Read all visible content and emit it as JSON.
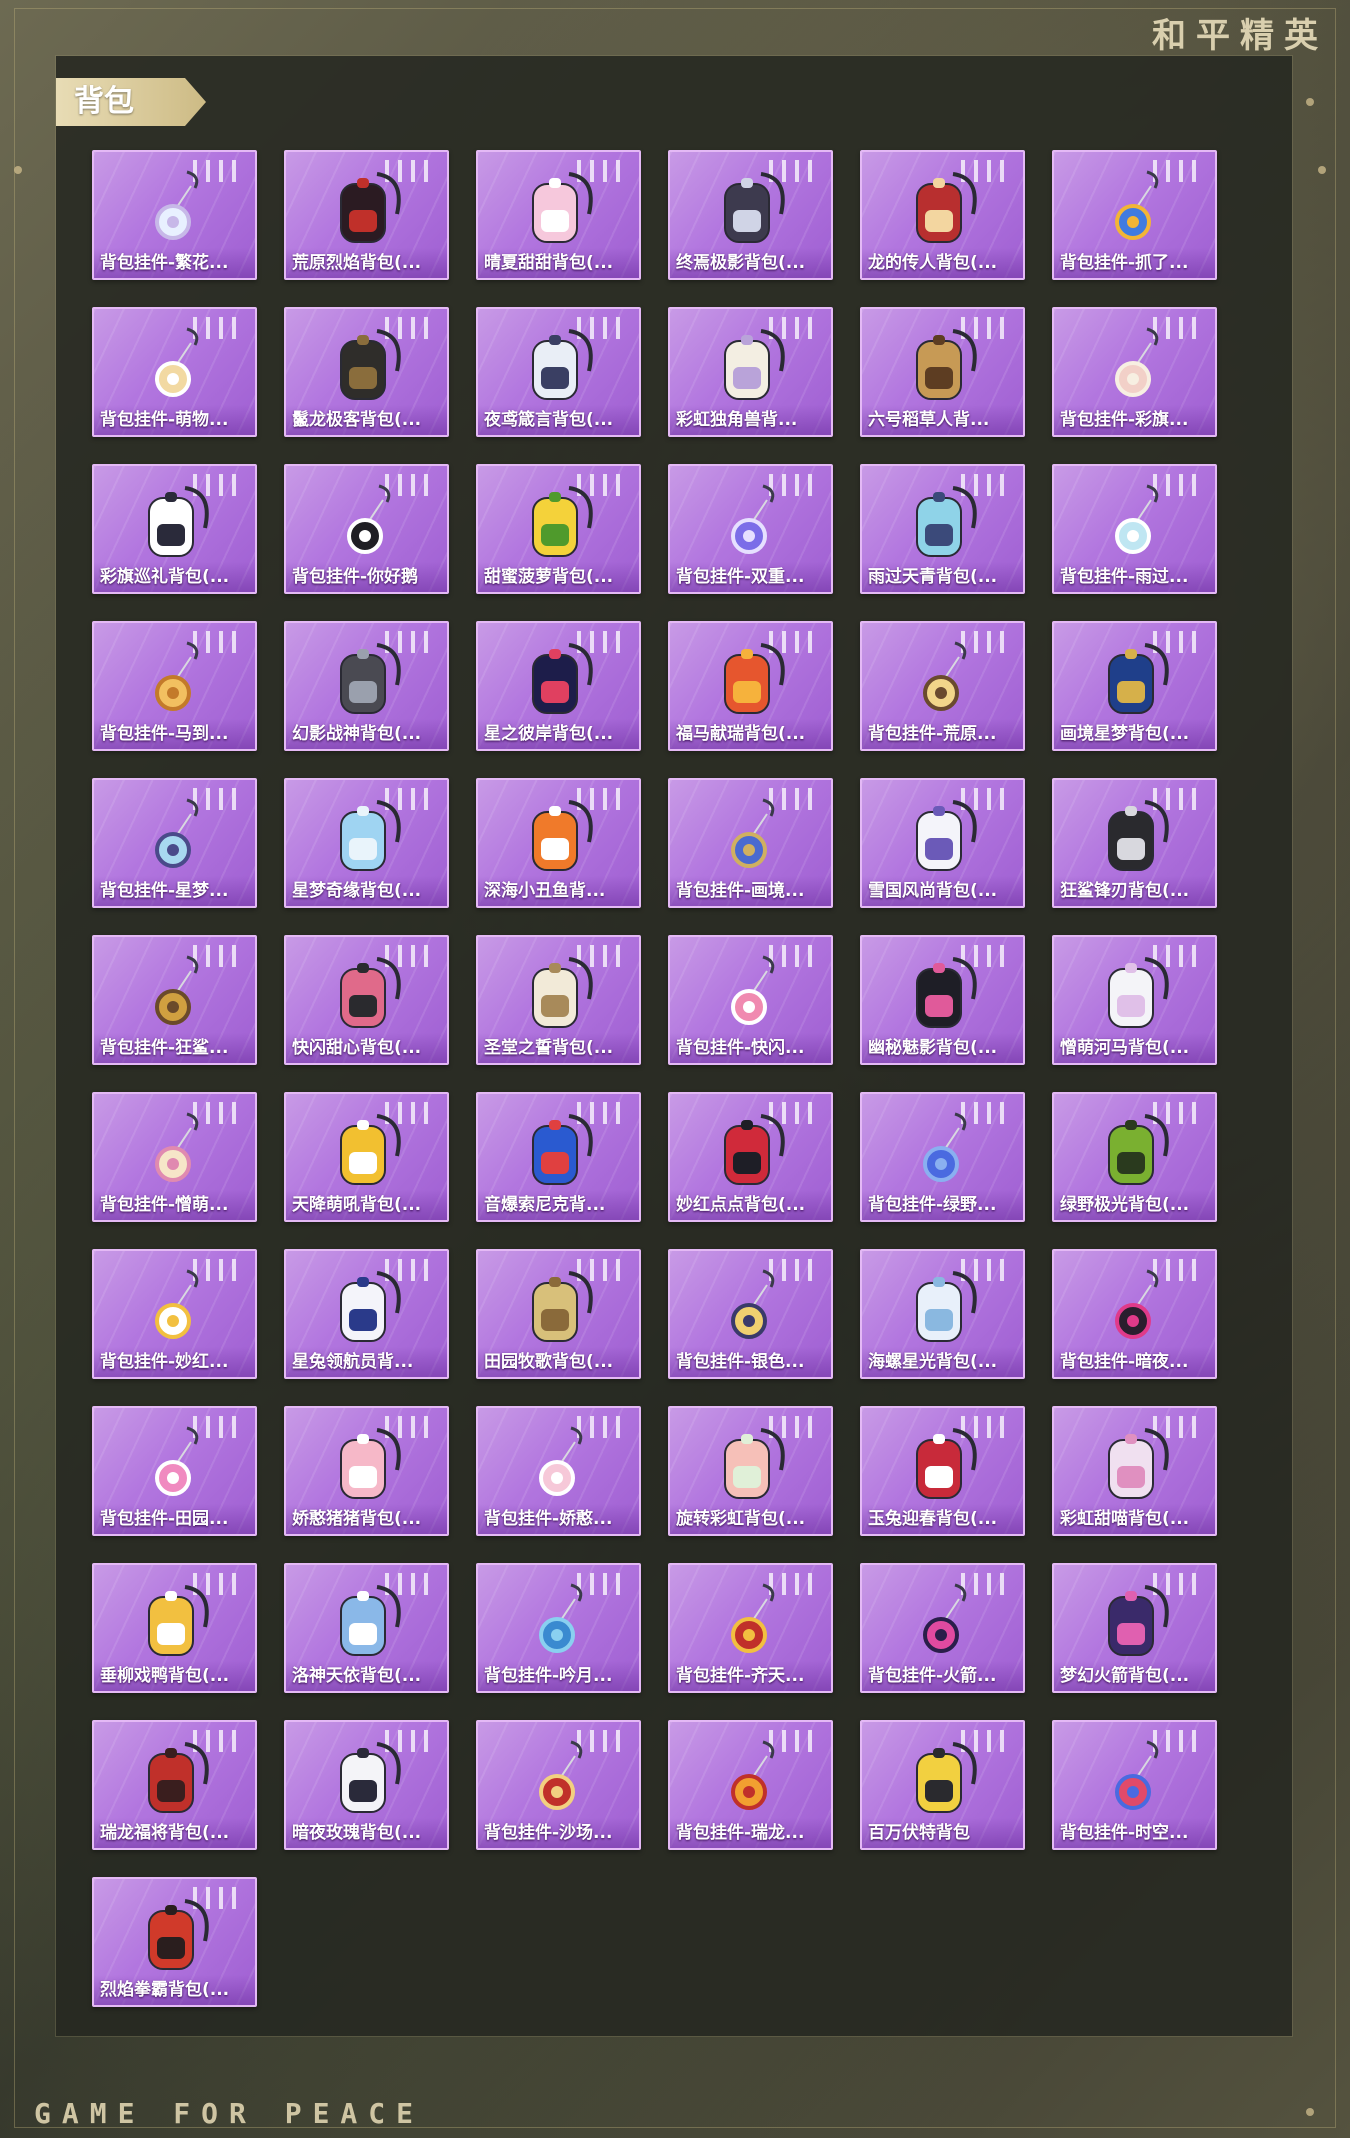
{
  "header": {
    "brand_title": "和平精英"
  },
  "footer": {
    "brand_en": "GAME FOR PEACE"
  },
  "section": {
    "title": "背包"
  },
  "items": [
    {
      "name": "背包挂件-繁花...",
      "type": "charm",
      "colors": [
        "#e8f0ff",
        "#c7b8e8"
      ]
    },
    {
      "name": "荒原烈焰背包(...",
      "type": "backpack",
      "colors": [
        "#2b1b22",
        "#c0302a"
      ]
    },
    {
      "name": "晴夏甜甜背包(...",
      "type": "backpack",
      "colors": [
        "#f6c8dc",
        "#ffffff"
      ]
    },
    {
      "name": "终焉极影背包(...",
      "type": "backpack",
      "colors": [
        "#3d3a4e",
        "#d0d4e6"
      ]
    },
    {
      "name": "龙的传人背包(...",
      "type": "backpack",
      "colors": [
        "#b82f2f",
        "#f3d6a0"
      ]
    },
    {
      "name": "背包挂件-抓了...",
      "type": "charm",
      "colors": [
        "#3f7be0",
        "#f2b536"
      ]
    },
    {
      "name": "背包挂件-萌物...",
      "type": "charm",
      "colors": [
        "#f2d9a2",
        "#ffffff"
      ]
    },
    {
      "name": "鬣龙极客背包(...",
      "type": "backpack",
      "colors": [
        "#2f2d2a",
        "#8a6d3c"
      ]
    },
    {
      "name": "夜鸢箴言背包(...",
      "type": "backpack",
      "colors": [
        "#e9eef6",
        "#3a3f63"
      ]
    },
    {
      "name": "彩虹独角兽背...",
      "type": "backpack",
      "colors": [
        "#f3eee2",
        "#b9a3d9"
      ]
    },
    {
      "name": "六号稻草人背...",
      "type": "backpack",
      "colors": [
        "#c79a55",
        "#5d3d22"
      ]
    },
    {
      "name": "背包挂件-彩旗...",
      "type": "charm",
      "colors": [
        "#f2d0c8",
        "#f7efe2"
      ]
    },
    {
      "name": "彩旗巡礼背包(...",
      "type": "backpack",
      "colors": [
        "#ffffff",
        "#2a2a3a"
      ]
    },
    {
      "name": "背包挂件-你好鹅",
      "type": "charm",
      "colors": [
        "#1f1f24",
        "#ffffff"
      ]
    },
    {
      "name": "甜蜜菠萝背包(...",
      "type": "backpack",
      "colors": [
        "#f4d23a",
        "#4f9a2c"
      ]
    },
    {
      "name": "背包挂件-双重...",
      "type": "charm",
      "colors": [
        "#7b6de8",
        "#e6e0ff"
      ]
    },
    {
      "name": "雨过天青背包(...",
      "type": "backpack",
      "colors": [
        "#8fd3e8",
        "#3b4a7a"
      ]
    },
    {
      "name": "背包挂件-雨过...",
      "type": "charm",
      "colors": [
        "#bfe6f2",
        "#ffffff"
      ]
    },
    {
      "name": "背包挂件-马到...",
      "type": "charm",
      "colors": [
        "#f2c060",
        "#c37a2a"
      ]
    },
    {
      "name": "幻影战神背包(...",
      "type": "backpack",
      "colors": [
        "#4a4a52",
        "#9aa0ad"
      ]
    },
    {
      "name": "星之彼岸背包(...",
      "type": "backpack",
      "colors": [
        "#1d1d4a",
        "#e04060"
      ]
    },
    {
      "name": "福马献瑞背包(...",
      "type": "backpack",
      "colors": [
        "#e6562e",
        "#f6b23c"
      ]
    },
    {
      "name": "背包挂件-荒原...",
      "type": "charm",
      "colors": [
        "#f2d58a",
        "#6a4a2e"
      ]
    },
    {
      "name": "画境星梦背包(...",
      "type": "backpack",
      "colors": [
        "#1f3f8a",
        "#d6b04a"
      ]
    },
    {
      "name": "背包挂件-星梦...",
      "type": "charm",
      "colors": [
        "#a8d8f0",
        "#4a4a8a"
      ]
    },
    {
      "name": "星梦奇缘背包(...",
      "type": "backpack",
      "colors": [
        "#9fd4f2",
        "#e9f4fb"
      ]
    },
    {
      "name": "深海小丑鱼背...",
      "type": "backpack",
      "colors": [
        "#f07a2a",
        "#ffffff"
      ]
    },
    {
      "name": "背包挂件-画境...",
      "type": "charm",
      "colors": [
        "#4a6ad0",
        "#d0b060"
      ]
    },
    {
      "name": "雪国风尚背包(...",
      "type": "backpack",
      "colors": [
        "#f4f4fa",
        "#6b5ab8"
      ]
    },
    {
      "name": "狂鲨锋刃背包(...",
      "type": "backpack",
      "colors": [
        "#2a2a2e",
        "#d8d8de"
      ]
    },
    {
      "name": "背包挂件-狂鲨...",
      "type": "charm",
      "colors": [
        "#d0a040",
        "#6a4a2a"
      ]
    },
    {
      "name": "快闪甜心背包(...",
      "type": "backpack",
      "colors": [
        "#e06a8a",
        "#2a2a2e"
      ]
    },
    {
      "name": "圣堂之誓背包(...",
      "type": "backpack",
      "colors": [
        "#f2ead8",
        "#a88a5a"
      ]
    },
    {
      "name": "背包挂件-快闪...",
      "type": "charm",
      "colors": [
        "#f08ab0",
        "#ffffff"
      ]
    },
    {
      "name": "幽秘魅影背包(...",
      "type": "backpack",
      "colors": [
        "#1e1e26",
        "#e05a9a"
      ]
    },
    {
      "name": "憎萌河马背包(...",
      "type": "backpack",
      "colors": [
        "#f4f4f8",
        "#e0c0e8"
      ]
    },
    {
      "name": "背包挂件-憎萌...",
      "type": "charm",
      "colors": [
        "#f6e6c8",
        "#e08ab0"
      ]
    },
    {
      "name": "天降萌吼背包(...",
      "type": "backpack",
      "colors": [
        "#f2c030",
        "#ffffff"
      ]
    },
    {
      "name": "音爆索尼克背...",
      "type": "backpack",
      "colors": [
        "#2a5ad0",
        "#e04040"
      ]
    },
    {
      "name": "妙红点点背包(...",
      "type": "backpack",
      "colors": [
        "#d02a3a",
        "#1e1e26"
      ]
    },
    {
      "name": "背包挂件-绿野...",
      "type": "charm",
      "colors": [
        "#4a6ae0",
        "#8ab0f0"
      ]
    },
    {
      "name": "绿野极光背包(...",
      "type": "backpack",
      "colors": [
        "#7ab030",
        "#2a3a1e"
      ]
    },
    {
      "name": "背包挂件-妙红...",
      "type": "charm",
      "colors": [
        "#ffffff",
        "#f2c040"
      ]
    },
    {
      "name": "星兔领航员背...",
      "type": "backpack",
      "colors": [
        "#f4f4fa",
        "#2a3a8a"
      ]
    },
    {
      "name": "田园牧歌背包(...",
      "type": "backpack",
      "colors": [
        "#d8c07a",
        "#8a6a3a"
      ]
    },
    {
      "name": "背包挂件-银色...",
      "type": "charm",
      "colors": [
        "#f0d070",
        "#3a3a6a"
      ]
    },
    {
      "name": "海螺星光背包(...",
      "type": "backpack",
      "colors": [
        "#e8f0fa",
        "#8ab8e0"
      ]
    },
    {
      "name": "背包挂件-暗夜...",
      "type": "charm",
      "colors": [
        "#2a1e2e",
        "#e03a8a"
      ]
    },
    {
      "name": "背包挂件-田园...",
      "type": "charm",
      "colors": [
        "#f08ac0",
        "#ffffff"
      ]
    },
    {
      "name": "娇憨猪猪背包(...",
      "type": "backpack",
      "colors": [
        "#f6b8c8",
        "#ffffff"
      ]
    },
    {
      "name": "背包挂件-娇憨...",
      "type": "charm",
      "colors": [
        "#f6c8d8",
        "#ffffff"
      ]
    },
    {
      "name": "旋转彩虹背包(...",
      "type": "backpack",
      "colors": [
        "#f6c0b8",
        "#e0f0d8"
      ]
    },
    {
      "name": "玉兔迎春背包(...",
      "type": "backpack",
      "colors": [
        "#c82a3a",
        "#ffffff"
      ]
    },
    {
      "name": "彩虹甜喵背包(...",
      "type": "backpack",
      "colors": [
        "#f0e0f0",
        "#e090c0"
      ]
    },
    {
      "name": "垂柳戏鸭背包(...",
      "type": "backpack",
      "colors": [
        "#f2c040",
        "#ffffff"
      ]
    },
    {
      "name": "洛神天依背包(...",
      "type": "backpack",
      "colors": [
        "#8ab8e8",
        "#ffffff"
      ]
    },
    {
      "name": "背包挂件-吟月...",
      "type": "charm",
      "colors": [
        "#3a8ad0",
        "#8ad0f0"
      ]
    },
    {
      "name": "背包挂件-齐天...",
      "type": "charm",
      "colors": [
        "#c0302a",
        "#f2c040"
      ]
    },
    {
      "name": "背包挂件-火箭...",
      "type": "charm",
      "colors": [
        "#e04aa0",
        "#2a1e4a"
      ]
    },
    {
      "name": "梦幻火箭背包(...",
      "type": "backpack",
      "colors": [
        "#3a2a6a",
        "#e060b0"
      ]
    },
    {
      "name": "瑞龙福将背包(...",
      "type": "backpack",
      "colors": [
        "#c0302a",
        "#3a1e1e"
      ]
    },
    {
      "name": "暗夜玫瑰背包(...",
      "type": "backpack",
      "colors": [
        "#f4f4f8",
        "#2a2a3a"
      ]
    },
    {
      "name": "背包挂件-沙场...",
      "type": "charm",
      "colors": [
        "#c0302a",
        "#f2d080"
      ]
    },
    {
      "name": "背包挂件-瑞龙...",
      "type": "charm",
      "colors": [
        "#f2a030",
        "#c0302a"
      ]
    },
    {
      "name": "百万伏特背包",
      "type": "backpack",
      "colors": [
        "#f2d040",
        "#2a2a2e"
      ]
    },
    {
      "name": "背包挂件-时空...",
      "type": "charm",
      "colors": [
        "#e04a6a",
        "#4a6ae0"
      ]
    },
    {
      "name": "烈焰拳霸背包(...",
      "type": "backpack",
      "colors": [
        "#d03a2a",
        "#2a1e1e"
      ]
    }
  ]
}
